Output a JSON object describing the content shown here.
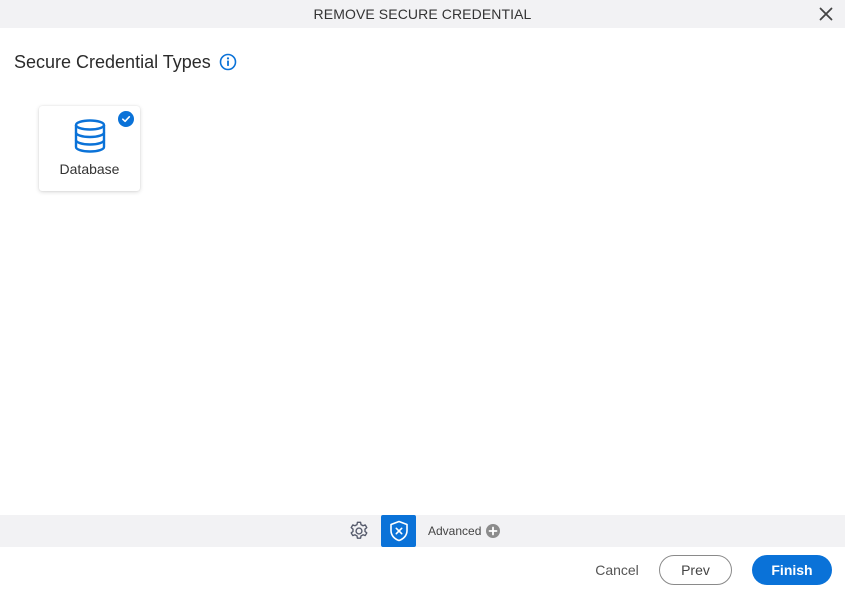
{
  "dialog": {
    "title": "REMOVE SECURE CREDENTIAL",
    "close_icon": "close-icon"
  },
  "section": {
    "title": "Secure Credential Types",
    "info_icon": "info-icon"
  },
  "credential_types": [
    {
      "label": "Database",
      "icon": "database-icon",
      "selected": true
    }
  ],
  "toolbar": {
    "settings_icon": "gear-icon",
    "shield_icon": "shield-remove-icon",
    "advanced_label": "Advanced",
    "advanced_icon": "plus-circle-icon"
  },
  "footer": {
    "cancel_label": "Cancel",
    "prev_label": "Prev",
    "finish_label": "Finish"
  },
  "colors": {
    "accent": "#0a72d8",
    "bar_background": "#f2f2f4"
  }
}
